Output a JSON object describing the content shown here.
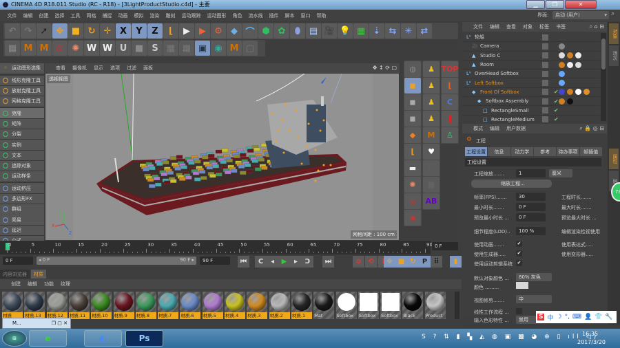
{
  "window": {
    "title": "CINEMA 4D R18.011 Studio (RC - R18) - [3LightProductStudio.c4d] - 主要",
    "minimize": "▁",
    "maximize": "❐",
    "close": "✕"
  },
  "menu": [
    "文件",
    "编辑",
    "创建",
    "选择",
    "工具",
    "网格",
    "捕捉",
    "动画",
    "模拟",
    "渲染",
    "雕刻",
    "运动跟踪",
    "运动图形",
    "角色",
    "流水线",
    "插件",
    "脚本",
    "窗口",
    "帮助"
  ],
  "layout": {
    "label": "界面:",
    "value": "启动 (用户)"
  },
  "toolbar1": [
    {
      "n": "undo-icon",
      "g": "↶",
      "c": "#777"
    },
    {
      "n": "redo-icon",
      "g": "↷",
      "c": "#777"
    },
    {
      "n": "live-selection-icon",
      "g": "➚",
      "c": "#222"
    },
    {
      "n": "move-icon",
      "g": "✥",
      "c": "#f0a020",
      "sel": true
    },
    {
      "n": "scale-icon",
      "g": "■",
      "c": "#f0b020"
    },
    {
      "n": "rotate-icon",
      "g": "↻",
      "c": "#f0a020"
    },
    {
      "n": "recent-tool-icon",
      "g": "✛",
      "c": "#f0a020"
    },
    {
      "n": "x-axis-icon",
      "g": "X",
      "c": "#111",
      "sel": true
    },
    {
      "n": "y-axis-icon",
      "g": "Y",
      "c": "#111",
      "sel": true
    },
    {
      "n": "z-axis-icon",
      "g": "Z",
      "c": "#111",
      "sel": true
    },
    {
      "n": "coordinate-system-icon",
      "g": "⌊",
      "c": "#f0a020"
    },
    {
      "n": "render-view-icon",
      "g": "▶",
      "c": "#eee"
    },
    {
      "n": "render-to-picture-viewer-icon",
      "g": "▶",
      "c": "#f06030"
    },
    {
      "n": "render-settings-icon",
      "g": "⚙",
      "c": "#f06030"
    },
    {
      "n": "cube-icon",
      "g": "◆",
      "c": "#6ab0e8"
    },
    {
      "n": "spline-pen-icon",
      "g": "⌒",
      "c": "#6ab0e8"
    },
    {
      "n": "subdivision-surface-icon",
      "g": "⬢",
      "c": "#30c060"
    },
    {
      "n": "array-icon",
      "g": "✿",
      "c": "#30c060"
    },
    {
      "n": "deformer-icon",
      "g": "⬮",
      "c": "#8aa0e0"
    },
    {
      "n": "floor-icon",
      "g": "▤",
      "c": "#aac8f0"
    },
    {
      "n": "camera-icon",
      "g": "🎥",
      "c": "#eee"
    },
    {
      "n": "light-icon",
      "g": "💡",
      "c": "#eee"
    },
    {
      "n": "emitter-icon",
      "g": "▦",
      "c": "#40c040"
    },
    {
      "n": "force-icon",
      "g": "⇣",
      "c": "#8af"
    },
    {
      "n": "attractor-icon",
      "g": "⇆",
      "c": "#8af"
    },
    {
      "n": "explosion-icon",
      "g": "✳",
      "c": "#8af"
    },
    {
      "n": "wind-icon",
      "g": "⇄",
      "c": "#8af"
    }
  ],
  "toolbar2": [
    {
      "n": "mograph-selection-icon",
      "g": "▦",
      "c": "#888"
    },
    {
      "n": "plugin-gear-icon",
      "g": "M",
      "c": "#d07000"
    },
    {
      "n": "plugin-gear-2-icon",
      "g": "M",
      "c": "#d07000"
    },
    {
      "n": "radial-red-icon",
      "g": "◎",
      "c": "#c33"
    },
    {
      "n": "radial-orange-icon",
      "g": "✺",
      "c": "#e86"
    },
    {
      "n": "w-tool-icon",
      "g": "W",
      "c": "#eee"
    },
    {
      "n": "w-tool-2-icon",
      "g": "W",
      "c": "#eee"
    },
    {
      "n": "u-icon",
      "g": "U",
      "c": "#ccc"
    },
    {
      "n": "square-icon",
      "g": "■",
      "c": "#888"
    },
    {
      "n": "s-icon",
      "g": "S",
      "c": "#ccc"
    },
    {
      "n": "pattern-icon",
      "g": "▦",
      "c": "#777"
    },
    {
      "n": "pattern-2-icon",
      "g": "▦",
      "c": "#777"
    },
    {
      "n": "window-panel-icon",
      "g": "▣",
      "c": "#234",
      "sel": true
    },
    {
      "n": "globe-icon",
      "g": "◉",
      "c": "#3a9"
    },
    {
      "n": "plugin-gear-3-icon",
      "g": "M",
      "c": "#d07000"
    },
    {
      "n": "box-outline-icon",
      "g": "▢",
      "c": "#777"
    }
  ],
  "mograph_palette": {
    "header": "运动图形选集",
    "groups": [
      [
        {
          "l": "线形克隆工具",
          "c": "#e0a040"
        },
        {
          "l": "放射克隆工具",
          "c": "#e0a040"
        },
        {
          "l": "网格克隆工具",
          "c": "#e0a040"
        }
      ],
      [
        {
          "l": "克隆",
          "c": "#40c070",
          "sel": true
        },
        {
          "l": "矩阵",
          "c": "#40c070"
        },
        {
          "l": "分裂",
          "c": "#40c070"
        },
        {
          "l": "实例",
          "c": "#40c070"
        },
        {
          "l": "文本",
          "c": "#40c070"
        },
        {
          "l": "追踪对象",
          "c": "#40c070"
        },
        {
          "l": "运动样条",
          "c": "#40c070"
        }
      ],
      [
        {
          "l": "运动挤压",
          "c": "#7aa0e0"
        },
        {
          "l": "多边形FX",
          "c": "#7aa0e0"
        },
        {
          "l": "群组",
          "c": "#7aa0e0"
        },
        {
          "l": "简易",
          "c": "#7aa0e0"
        },
        {
          "l": "延迟",
          "c": "#7aa0e0"
        },
        {
          "l": "公式",
          "c": "#7aa0e0"
        }
      ]
    ]
  },
  "viewport": {
    "menu": [
      "查看",
      "摄像机",
      "显示",
      "选项",
      "过滤",
      "面板"
    ],
    "view_name": "透视视图",
    "grid_spacing": "网格间距 : 100 cm",
    "axes": {
      "x": "X",
      "y": "Y",
      "z": "Z"
    }
  },
  "vtools": {
    "col1": [
      {
        "n": "sphere-globe-icon",
        "g": "◍",
        "c": "#888"
      },
      {
        "n": "model-mode-icon",
        "g": "◼",
        "c": "#f0a020",
        "sel": true
      },
      {
        "n": "points-mode-icon",
        "g": "◼",
        "c": "#aaa"
      },
      {
        "n": "edges-mode-icon",
        "g": "◼",
        "c": "#aaa"
      },
      {
        "n": "polygons-mode-icon",
        "g": "◆",
        "c": "#f08020"
      },
      {
        "n": "axis-icon",
        "g": "⌊",
        "c": "#f0a020"
      },
      {
        "n": "gradient-icon",
        "g": "▬",
        "c": "#eee"
      },
      {
        "n": "radial-orange-icon",
        "g": "✺",
        "c": "#e86"
      },
      {
        "n": "radial-red-icon",
        "g": "◎",
        "c": "#c33"
      },
      {
        "n": "radial-dot-icon",
        "g": "◉",
        "c": "#c33"
      }
    ],
    "col2": [
      {
        "n": "people-group-icon",
        "g": "♟",
        "c": "#f0c020"
      },
      {
        "n": "people-pair-icon",
        "g": "♟",
        "c": "#f0c020"
      },
      {
        "n": "person-icon",
        "g": "♟",
        "c": "#f0c020"
      },
      {
        "n": "people-trio-icon",
        "g": "♟",
        "c": "#f0c020"
      },
      {
        "n": "plugin-gear-icon",
        "g": "M",
        "c": "#d07000"
      },
      {
        "n": "heart-icon",
        "g": "♥",
        "c": "#fff"
      },
      {
        "n": "swirl-icon",
        "g": "◌",
        "c": "#666"
      },
      {
        "n": "pattern-icon",
        "g": "▦",
        "c": "#666"
      },
      {
        "n": "ab-icon",
        "g": "AB",
        "c": "#60c"
      }
    ],
    "col3": [
      {
        "n": "top-text-icon",
        "g": "TOP",
        "c": "#d33"
      },
      {
        "n": "link-icon",
        "g": "⌊",
        "c": "#f06020"
      },
      {
        "n": "coordinate-c-icon",
        "g": "C",
        "c": "#4a7ae0"
      },
      {
        "n": "cloth-icon",
        "g": "❚",
        "c": "#d22"
      },
      {
        "n": "character-icon",
        "g": "♙",
        "c": "#30d080"
      }
    ]
  },
  "object_manager": {
    "menu": [
      "文件",
      "编辑",
      "查看",
      "对象",
      "标签",
      "书签"
    ],
    "rows": [
      {
        "name": "轮船",
        "indent": 0,
        "icon": "null-icon",
        "g": "L⁰",
        "color": "#d6d6d6",
        "tags": []
      },
      {
        "name": "Camera",
        "indent": 1,
        "icon": "camera-icon",
        "g": "🎥",
        "color": "#d6d6d6",
        "tags": [
          "#888"
        ]
      },
      {
        "name": "Studio C",
        "indent": 1,
        "icon": "light-icon",
        "g": "▲",
        "color": "#d6d6d6",
        "tags": [
          "#ddd",
          "#d08020",
          "#eee"
        ]
      },
      {
        "name": "Room",
        "indent": 1,
        "icon": "light-icon",
        "g": "▲",
        "color": "#d6d6d6",
        "tags": [
          "#d08020",
          "#eee",
          "#ddd"
        ]
      },
      {
        "name": "OverHead Softbox",
        "indent": 0,
        "icon": "null-icon",
        "g": "L⁰",
        "color": "#d6d6d6",
        "tags": [
          "#6af"
        ]
      },
      {
        "name": "Left Softbox",
        "indent": 0,
        "icon": "null-icon",
        "g": "L⁰",
        "color": "#e0902a",
        "tags": [
          "#6af"
        ]
      },
      {
        "name": "Front Of Softbox",
        "indent": 1,
        "icon": "instance-icon",
        "g": "◆",
        "color": "#e0902a",
        "tags": [
          "#44c",
          "#d08020",
          "#fff",
          "#e0902a"
        ],
        "check": true
      },
      {
        "name": "Softbox Assembly",
        "indent": 2,
        "icon": "subdivision-icon",
        "g": "◆",
        "color": "#d6d6d6",
        "tags": [
          "#d08020",
          "#111"
        ],
        "check": true
      },
      {
        "name": "RectangleSmall",
        "indent": 3,
        "icon": "rectangle-spline-icon",
        "g": "□",
        "color": "#d6d6d6",
        "tags": [],
        "check": true
      },
      {
        "name": "RectangleMedium",
        "indent": 3,
        "icon": "rectangle-spline-icon",
        "g": "□",
        "color": "#d6d6d6",
        "tags": [],
        "check": true
      }
    ]
  },
  "right_tabs": [
    "对象",
    "场次",
    "属性",
    "层"
  ],
  "attributes": {
    "menu": [
      "模式",
      "编辑",
      "用户数据"
    ],
    "object": "工程",
    "tabs": [
      "工程设置",
      "信息",
      "动力学",
      "参考",
      "待办事项",
      "帧插值"
    ],
    "section": "工程设置",
    "scale_label": "工程缩放.......",
    "scale_value": "1",
    "scale_unit": "厘米",
    "scale_button": "缩放工程...",
    "fps_label": "帧率(FPS).......",
    "fps": "30",
    "min_label": "最小时长.......",
    "min": "0 F",
    "pmin_label": "预览最小时长 ...",
    "pmin": "0 F",
    "proj_len": "工程时长.......",
    "max_len": "最大时长.......",
    "pmax": "预览最大时长 ...",
    "lod_label": "细节程度(LOD)..",
    "lod": "100 %",
    "render_lod": "编辑渲染检视使用",
    "use_anim": "使用动画.......",
    "use_gen": "使用生成器.....",
    "use_mot": "使用运动剪辑系统",
    "use_expr": "使用表达式.....",
    "use_deform": "使用变形器.....",
    "obj_color_label": "默认对象颜色 ...",
    "obj_color": "80% 灰色",
    "color_label": "颜色 .........",
    "clip_label": "视图修剪.......",
    "clip": "中",
    "linear_label": "线性工作流程 ...",
    "input_label": "输入色彩特性 ...",
    "input": "禁用",
    "swatch": "#d8d8d8"
  },
  "timeline": {
    "start": 0,
    "end": 90,
    "step": 5,
    "current": 0
  },
  "playback": {
    "current": "0 F",
    "range_start": "◂ 0 F",
    "range_end": "90 F ▸",
    "end": "90 F",
    "right_frame": "0 F",
    "buttons": [
      {
        "n": "go-to-start-icon",
        "g": "⏮"
      },
      {
        "n": "prev-key-icon",
        "g": "C"
      },
      {
        "n": "prev-frame-icon",
        "g": "◂"
      },
      {
        "n": "play-icon",
        "g": "▶",
        "c": "#3c3"
      },
      {
        "n": "next-frame-icon",
        "g": "▸"
      },
      {
        "n": "next-key-icon",
        "g": "Ↄ"
      },
      {
        "n": "go-to-end-icon",
        "g": "⏭"
      },
      {
        "n": "record-keys-icon",
        "g": "⊘",
        "c": "#e33"
      },
      {
        "n": "auto-key-icon",
        "g": "⟲",
        "c": "#e33"
      },
      {
        "n": "key-help-icon",
        "g": "?",
        "c": "#e33"
      },
      {
        "n": "key-position-icon",
        "g": "✥",
        "c": "#f0a020",
        "sel": true
      },
      {
        "n": "key-scale-icon",
        "g": "■",
        "c": "#f0a020",
        "sel": true
      },
      {
        "n": "key-rotation-icon",
        "g": "↻",
        "c": "#f0a020",
        "sel": true
      },
      {
        "n": "key-param-icon",
        "g": "P",
        "c": "#222",
        "sel": true
      },
      {
        "n": "key-pla-icon",
        "g": "⠿",
        "c": "#222"
      },
      {
        "n": "timeline-icon",
        "g": "▮",
        "c": "#f0a020",
        "sel": true
      }
    ]
  },
  "materials_panel": {
    "tabs": [
      "内容浏览器",
      "材质"
    ],
    "menu": [
      "创建",
      "编辑",
      "功能",
      "纹理"
    ],
    "items": [
      {
        "l": "材质",
        "c": "#3d4a5a",
        "o": true
      },
      {
        "l": "材质.13",
        "c": "#2f3b4a",
        "o": true
      },
      {
        "l": "材质.12",
        "c": "#9a9e96",
        "o": true
      },
      {
        "l": "材质.11",
        "c": "#4a3e38",
        "o": true
      },
      {
        "l": "材质.10",
        "c": "#3a8a20",
        "o": true
      },
      {
        "l": "材质.9",
        "c": "#6a1520",
        "o": true
      },
      {
        "l": "材质.8",
        "c": "#3a9a5a",
        "o": true
      },
      {
        "l": "材质.7",
        "c": "#4aaab0",
        "o": true
      },
      {
        "l": "材质.6",
        "c": "#6a8ac8",
        "o": true
      },
      {
        "l": "材质.5",
        "c": "#b07ad0",
        "o": true
      },
      {
        "l": "材质.4",
        "c": "#c8c020",
        "o": true
      },
      {
        "l": "材质.3",
        "c": "#d08a20",
        "o": true
      },
      {
        "l": "材质.2",
        "c": "#b8b8b8",
        "o": true
      },
      {
        "l": "材质.1",
        "c": "#252525",
        "o": true
      },
      {
        "l": "Mat",
        "c": "#1a1a1a"
      },
      {
        "l": "Softbox",
        "c": "#ffffff"
      },
      {
        "l": "Softbox",
        "c": "#ffffff",
        "sq": true
      },
      {
        "l": "Softbox",
        "c": "#ffffff",
        "sq": true
      },
      {
        "l": "Black",
        "c": "#080808"
      },
      {
        "l": "Product",
        "c": "#c4c4c4"
      }
    ]
  },
  "mini_window": {
    "title": "M..."
  },
  "ime": {
    "items": [
      "S",
      "中",
      "☽",
      "°,",
      "⌨",
      "👤",
      "👕",
      "🔧"
    ]
  },
  "badge": "73",
  "taskbar": {
    "apps": [
      {
        "n": "start-button",
        "g": "⊞"
      },
      {
        "n": "browser-icon",
        "g": "e"
      },
      {
        "n": "cinema4d-icon",
        "g": "◐"
      },
      {
        "n": "photoshop-icon",
        "g": "Ps"
      }
    ],
    "time": "16:35",
    "date": "2017/3/20"
  }
}
